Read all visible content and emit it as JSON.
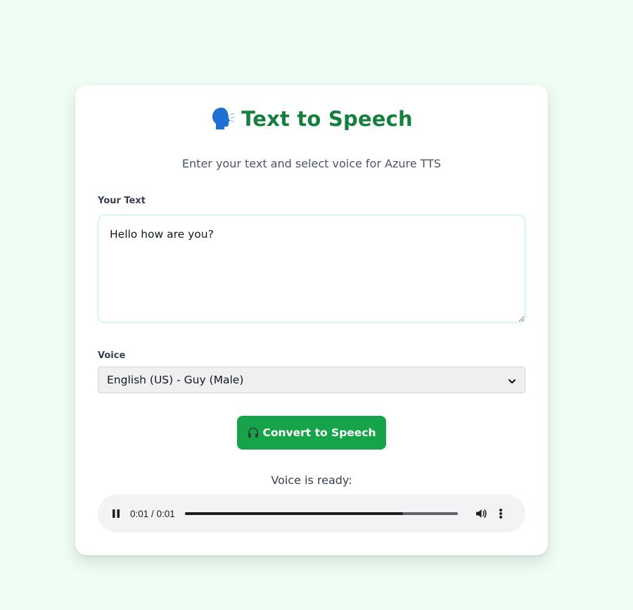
{
  "header": {
    "icon": "speaking-head-icon",
    "title": "Text to Speech",
    "subtitle": "Enter your text and select voice for Azure TTS"
  },
  "form": {
    "text_label": "Your Text",
    "text_value": "Hello how are you?",
    "voice_label": "Voice",
    "voice_selected": "English (US) - Guy (Male)"
  },
  "convert_button": {
    "icon": "headphones-icon",
    "label": "Convert to Speech"
  },
  "result": {
    "status": "Voice is ready:"
  },
  "player": {
    "state": "playing",
    "time": "0:01 / 0:01",
    "progress": 0.8
  },
  "colors": {
    "background": "#f0fdf4",
    "title": "#15803d",
    "button": "#16a34a",
    "textarea_border": "#bbf7d0"
  }
}
